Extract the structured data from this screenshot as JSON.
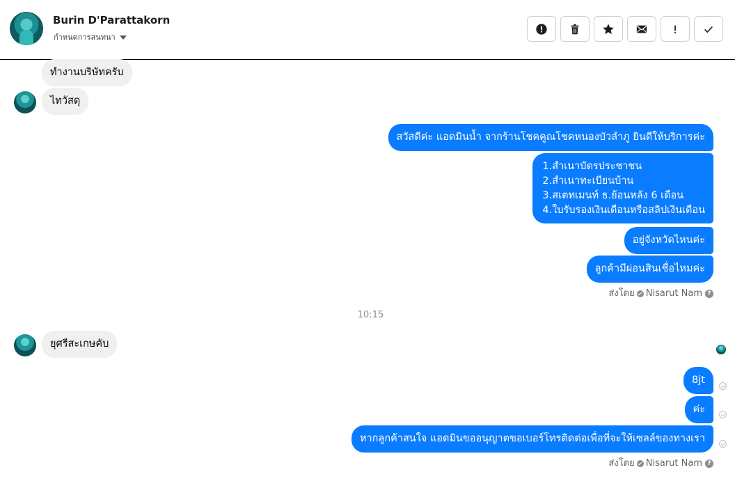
{
  "header": {
    "name": "Burin D'Parattakorn",
    "subtitle": "กำหนดการสนทนา"
  },
  "toolbar": [
    {
      "name": "alert-icon",
      "glyph": "alert-circle"
    },
    {
      "name": "trash-icon",
      "glyph": "trash"
    },
    {
      "name": "star-icon",
      "glyph": "star"
    },
    {
      "name": "mail-icon",
      "glyph": "envelope"
    },
    {
      "name": "exclamation-icon",
      "glyph": "exclamation"
    },
    {
      "name": "check-icon",
      "glyph": "checkmark"
    }
  ],
  "messages": {
    "in1": "ทำงานบริษัทครับ",
    "in2": "ไทวัสดุ",
    "out1": "สวัสดีค่ะ แอดมินน้ำ จากร้านโชคคูณโชคหนองบัวลำภู ยินดีให้บริการค่ะ",
    "out2_lines": [
      "1.สำเนาบัตรประชาชน",
      "2.สำเนาทะเบียนบ้าน",
      "3.สเตทเมนท์ ธ.ย้อนหลัง 6 เดือน",
      "4.ใบรับรองเงินเดือนหรือสลิปเงินเดือน"
    ],
    "out3": "อยู่จังหวัดไหนค่ะ",
    "out4": "ลูกค้ามีผ่อนสินเชื่อไหมค่ะ",
    "sent_by_1": {
      "label": "ส่งโดย",
      "name": "Nisarut Nam"
    },
    "timestamp": "10:15",
    "in3": "ยุศรีสะเกษคับ",
    "out5": "8jt",
    "out6": "ค่ะ",
    "out7": "หากลูกค้าสนใจ แอดมินขออนุญาตขอเบอร์โทรติดต่อเพื่อที่จะให้เซลล์ของทางเรา",
    "sent_by_2": {
      "label": "ส่งโดย",
      "name": "Nisarut Nam"
    }
  },
  "colors": {
    "outgoing_bubble": "#0a7cff",
    "incoming_bubble": "#f0f0f0"
  }
}
